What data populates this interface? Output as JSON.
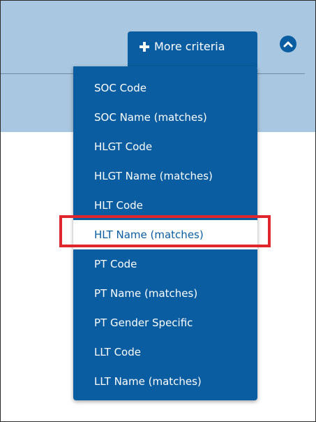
{
  "toolbar": {
    "more_criteria_label": "More criteria"
  },
  "menu": {
    "items": [
      {
        "label": "SOC Code"
      },
      {
        "label": "SOC Name (matches)"
      },
      {
        "label": "HLGT Code"
      },
      {
        "label": "HLGT Name (matches)"
      },
      {
        "label": "HLT Code"
      },
      {
        "label": "HLT Name (matches)",
        "highlighted": true
      },
      {
        "label": "PT Code"
      },
      {
        "label": "PT Name (matches)"
      },
      {
        "label": "PT Gender Specific"
      },
      {
        "label": "LLT Code"
      },
      {
        "label": "LLT Name (matches)"
      }
    ]
  },
  "icons": {
    "add": "plus-icon",
    "collapse": "chevron-up-icon"
  },
  "colors": {
    "panel_background": "#a9c7e0",
    "menu_background": "#0a5da0",
    "highlight_border": "#e0262d"
  }
}
